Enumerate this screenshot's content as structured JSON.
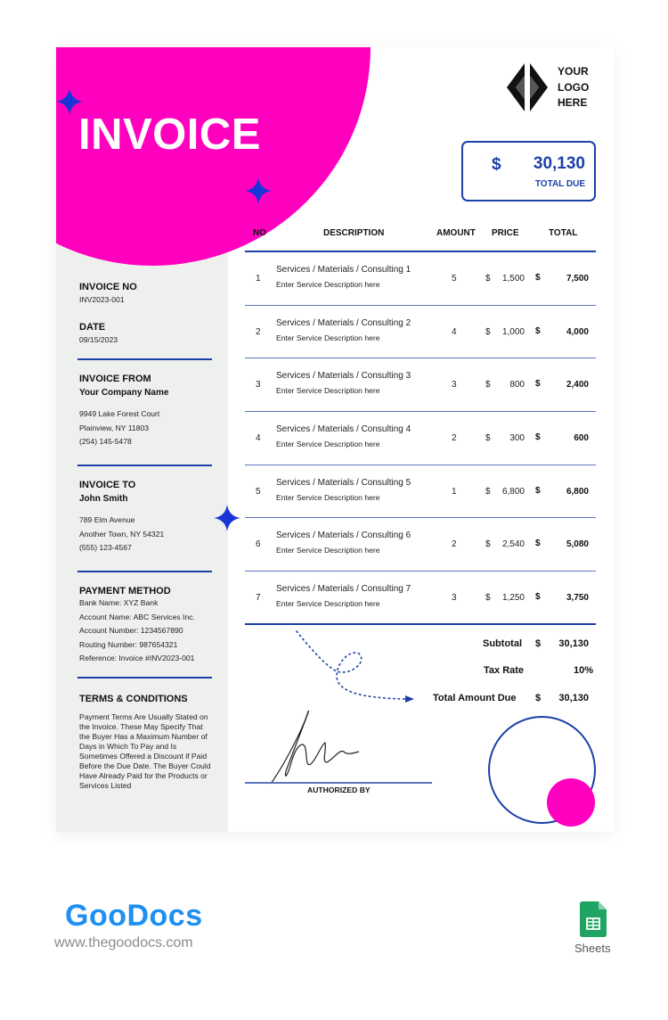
{
  "header": {
    "title": "INVOICE",
    "logo_lines": [
      "YOUR",
      "LOGO",
      "HERE"
    ]
  },
  "total_due_box": {
    "currency": "$",
    "amount": "30,130",
    "label": "TOTAL DUE"
  },
  "sidebar": {
    "invoice_no": {
      "label": "INVOICE NO",
      "value": "INV2023-001"
    },
    "date": {
      "label": "DATE",
      "value": "09/15/2023"
    },
    "invoice_from": {
      "label": "INVOICE FROM",
      "name": "Your Company Name",
      "lines": [
        "9949 Lake Forest Court",
        "Plainview, NY 11803",
        "(254) 145-5478"
      ]
    },
    "invoice_to": {
      "label": "INVOICE TO",
      "name": "John Smith",
      "lines": [
        "789 Elm Avenue",
        "Another Town, NY 54321",
        "(555) 123-4567"
      ]
    },
    "payment_method": {
      "label": "PAYMENT METHOD",
      "lines": [
        "Bank Name: XYZ Bank",
        "Account Name: ABC Services Inc.",
        "Account Number: 1234567890",
        "Routing Number: 987654321",
        "Reference: Invoice #INV2023-001"
      ]
    },
    "terms": {
      "label": "TERMS & CONDITIONS",
      "text": "Payment Terms Are Usually Stated on the Invoice. These May Specify That the Buyer Has a Maximum Number of Days in Which To Pay and Is Sometimes Offered a Discount if Paid Before the Due Date. The Buyer Could Have Already Paid for the Products or Services Listed"
    }
  },
  "table": {
    "headers": {
      "no": "NO",
      "description": "DESCRIPTION",
      "amount": "AMOUNT",
      "price": "PRICE",
      "total": "TOTAL"
    },
    "currency": "$",
    "rows": [
      {
        "no": "1",
        "title": "Services / Materials / Consulting 1",
        "desc": "Enter Service Description here",
        "amount": "5",
        "price": "1,500",
        "total": "7,500"
      },
      {
        "no": "2",
        "title": "Services / Materials / Consulting 2",
        "desc": "Enter Service Description here",
        "amount": "4",
        "price": "1,000",
        "total": "4,000"
      },
      {
        "no": "3",
        "title": "Services / Materials / Consulting 3",
        "desc": "Enter Service Description here",
        "amount": "3",
        "price": "800",
        "total": "2,400"
      },
      {
        "no": "4",
        "title": "Services / Materials / Consulting 4",
        "desc": "Enter Service Description here",
        "amount": "2",
        "price": "300",
        "total": "600"
      },
      {
        "no": "5",
        "title": "Services / Materials / Consulting 5",
        "desc": "Enter Service Description here",
        "amount": "1",
        "price": "6,800",
        "total": "6,800"
      },
      {
        "no": "6",
        "title": "Services / Materials / Consulting 6",
        "desc": "Enter Service Description here",
        "amount": "2",
        "price": "2,540",
        "total": "5,080"
      },
      {
        "no": "7",
        "title": "Services / Materials / Consulting 7",
        "desc": "Enter Service Description here",
        "amount": "3",
        "price": "1,250",
        "total": "3,750"
      }
    ]
  },
  "summary": {
    "subtotal_label": "Subtotal",
    "subtotal_currency": "$",
    "subtotal": "30,130",
    "tax_label": "Tax Rate",
    "tax": "10%",
    "total_label": "Total Amount Due",
    "total_currency": "$",
    "total": "30,130"
  },
  "signature": {
    "label": "AUTHORIZED BY"
  },
  "footer": {
    "brand": "GooDocs",
    "url": "www.thegoodocs.com",
    "app_label": "Sheets"
  },
  "colors": {
    "accent_pink": "#ff00bf",
    "accent_blue": "#1c3fa8",
    "sidebar_bg": "#eef0ee"
  }
}
